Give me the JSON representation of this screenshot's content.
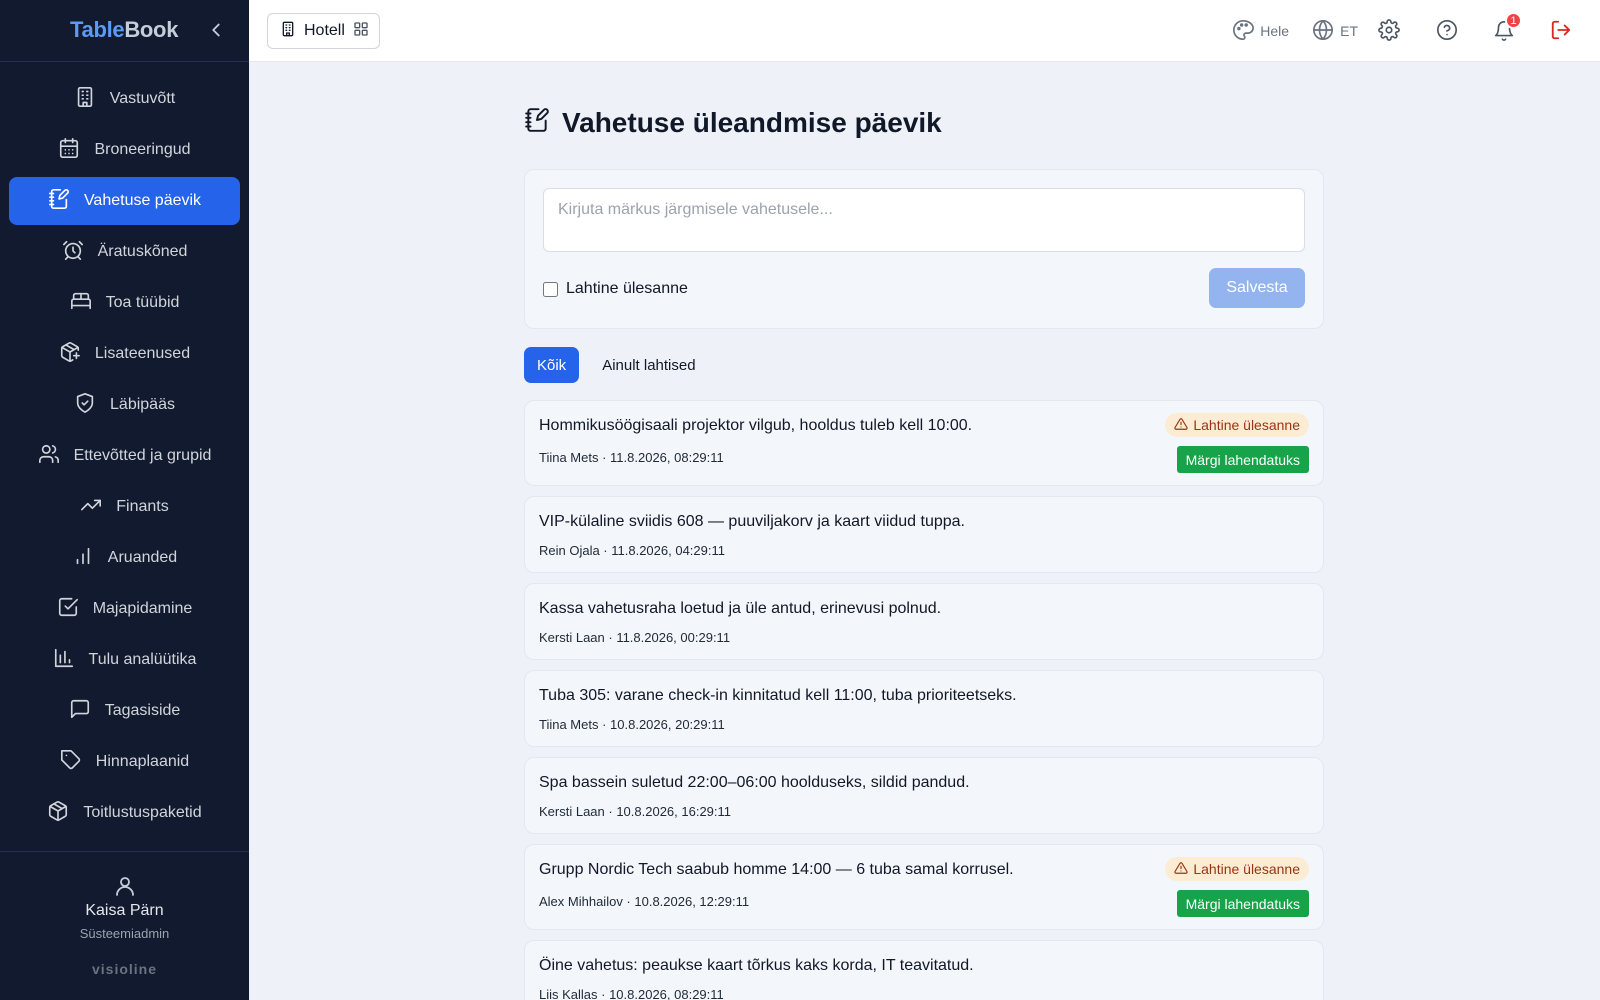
{
  "brand": {
    "part1": "Table",
    "part2": "Book"
  },
  "sidebar": {
    "items": [
      {
        "label": "Vastuvõtt",
        "icon": "building-icon"
      },
      {
        "label": "Broneeringud",
        "icon": "calendar-icon"
      },
      {
        "label": "Vahetuse päevik",
        "icon": "notebook-pen-icon",
        "active": true
      },
      {
        "label": "Äratuskõned",
        "icon": "alarm-clock-icon"
      },
      {
        "label": "Toa tüübid",
        "icon": "bed-icon"
      },
      {
        "label": "Lisateenused",
        "icon": "package-plus-icon"
      },
      {
        "label": "Läbipääs",
        "icon": "shield-check-icon"
      },
      {
        "label": "Ettevõtted ja grupid",
        "icon": "users-icon"
      },
      {
        "label": "Finants",
        "icon": "trending-up-icon"
      },
      {
        "label": "Aruanded",
        "icon": "bar-chart-icon"
      },
      {
        "label": "Majapidamine",
        "icon": "check-square-icon"
      },
      {
        "label": "Tulu analüütika",
        "icon": "bar-chart-axis-icon"
      },
      {
        "label": "Tagasiside",
        "icon": "message-square-icon"
      },
      {
        "label": "Hinnaplaanid",
        "icon": "tag-icon"
      },
      {
        "label": "Toitlustuspaketid",
        "icon": "box-icon"
      }
    ],
    "user": {
      "name": "Kaisa Pärn",
      "role": "Süsteemiadmin"
    },
    "vendor": "visioline"
  },
  "topbar": {
    "property": "Hotell",
    "theme_label": "Hele",
    "language_label": "ET",
    "notification_count": "1"
  },
  "main": {
    "title": "Vahetuse üleandmise päevik",
    "composer": {
      "placeholder": "Kirjuta märkus järgmisele vahetusele...",
      "value": "",
      "checkbox_label": "Lahtine ülesanne",
      "checked": false,
      "save_label": "Salvesta"
    },
    "filters": [
      {
        "label": "Kõik",
        "active": true
      },
      {
        "label": "Ainult lahtised",
        "active": false
      }
    ],
    "open_tag_label": "Lahtine ülesanne",
    "resolve_label": "Märgi lahendatuks",
    "notes": [
      {
        "text": "Hommikusöögisaali projektor vilgub, hooldus tuleb kell 10:00.",
        "meta": "Tiina Mets · 11.8.2026, 08:29:11",
        "open": true
      },
      {
        "text": "VIP-külaline sviidis 608 — puuviljakorv ja kaart viidud tuppa.",
        "meta": "Rein Ojala · 11.8.2026, 04:29:11",
        "open": false
      },
      {
        "text": "Kassa vahetusraha loetud ja üle antud, erinevusi polnud.",
        "meta": "Kersti Laan · 11.8.2026, 00:29:11",
        "open": false
      },
      {
        "text": "Tuba 305: varane check-in kinnitatud kell 11:00, tuba prioriteetseks.",
        "meta": "Tiina Mets · 10.8.2026, 20:29:11",
        "open": false
      },
      {
        "text": "Spa bassein suletud 22:00–06:00 hoolduseks, sildid pandud.",
        "meta": "Kersti Laan · 10.8.2026, 16:29:11",
        "open": false
      },
      {
        "text": "Grupp Nordic Tech saabub homme 14:00 — 6 tuba samal korrusel.",
        "meta": "Alex Mihhailov · 10.8.2026, 12:29:11",
        "open": true
      },
      {
        "text": "Öine vahetus: peaukse kaart tõrkus kaks korda, IT teavitatud.",
        "meta": "Liis Kallas · 10.8.2026, 08:29:11",
        "open": false
      }
    ]
  },
  "colors": {
    "sidebar_bg": "#111a2e",
    "accent": "#2563eb",
    "success": "#16a34a",
    "warning_bg": "#fdecd4",
    "danger": "#dc2626"
  }
}
